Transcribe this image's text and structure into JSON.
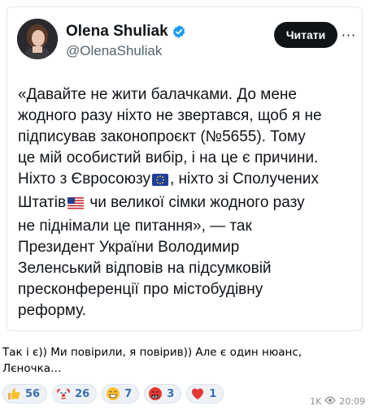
{
  "tweet": {
    "author_name": "Olena Shuliak",
    "author_handle": "@OlenaShuliak",
    "follow_label": "Читати",
    "more_label": "···",
    "lines": [
      "«Давайте не жити балачками. До мене",
      "жодного разу ніхто не звертався, щоб я не",
      "підписував законопроєкт (№5655). Тому",
      "це мій особистий вибір, і на це є причини.",
      "Ніхто з Євросоюзу",
      ", ніхто зі Сполучених",
      "Штатів",
      " чи великої сімки жодного разу",
      "не піднімали це питання», — так",
      "Президент України Володимир",
      "Зеленський відповів на підсумковій",
      "пресконференції про містобудівну",
      "реформу."
    ]
  },
  "caption": {
    "line1": "Так і є)) Ми повірили, я повірив)) Але є один нюанс,",
    "line2": "Лєночка…"
  },
  "reactions": [
    {
      "icon": "thumbs-up-icon",
      "count": "56"
    },
    {
      "icon": "clown-icon",
      "count": "26"
    },
    {
      "icon": "grinning-icon",
      "count": "7"
    },
    {
      "icon": "cursing-face-icon",
      "count": "3"
    },
    {
      "icon": "heart-icon",
      "count": "1"
    }
  ],
  "meta": {
    "views": "1K",
    "time": "20:09"
  },
  "colors": {
    "follow_bg": "#0f1419",
    "verified": "#1d9bf0",
    "reaction_count": "#3a6fb0"
  }
}
